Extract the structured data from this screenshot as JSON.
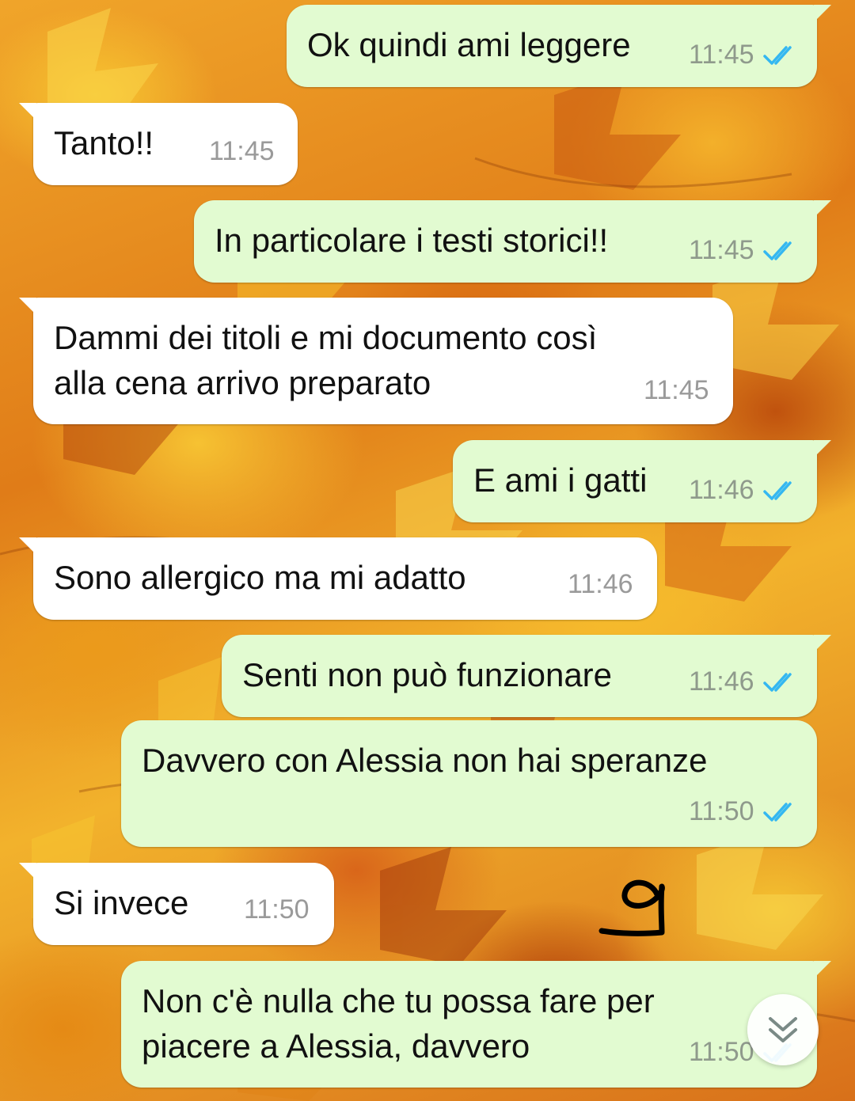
{
  "colors": {
    "outgoing_bubble": "#e2fbd1",
    "incoming_bubble": "#ffffff",
    "read_ticks": "#34b7f1",
    "timestamp": "#8f9a8c"
  },
  "messages": [
    {
      "direction": "out",
      "text": "Ok quindi ami leggere",
      "time": "11:45",
      "status": "read"
    },
    {
      "direction": "in",
      "text": "Tanto!!",
      "time": "11:45"
    },
    {
      "direction": "out",
      "text": "In particolare i testi storici!!",
      "time": "11:45",
      "status": "read"
    },
    {
      "direction": "in",
      "text": "Dammi dei titoli e mi documento così\nalla cena arrivo preparato",
      "time": "11:45"
    },
    {
      "direction": "out",
      "text": "E ami i gatti",
      "time": "11:46",
      "status": "read"
    },
    {
      "direction": "in",
      "text": "Sono allergico ma mi adatto",
      "time": "11:46"
    },
    {
      "direction": "out",
      "text": "Senti non può funzionare",
      "time": "11:46",
      "status": "read"
    },
    {
      "direction": "out",
      "text": "Davvero con Alessia non hai speranze",
      "time": "11:50",
      "status": "read"
    },
    {
      "direction": "in",
      "text": "Si invece",
      "time": "11:50"
    },
    {
      "direction": "out",
      "text": "Non c'è nulla che tu possa fare per\npiacere a Alessia, davvero",
      "time": "11:50",
      "status": "read"
    }
  ],
  "annotation": {
    "text": "9"
  },
  "icons": {
    "read_receipt": "double-check-icon",
    "scroll_down": "double-chevron-down-icon"
  }
}
